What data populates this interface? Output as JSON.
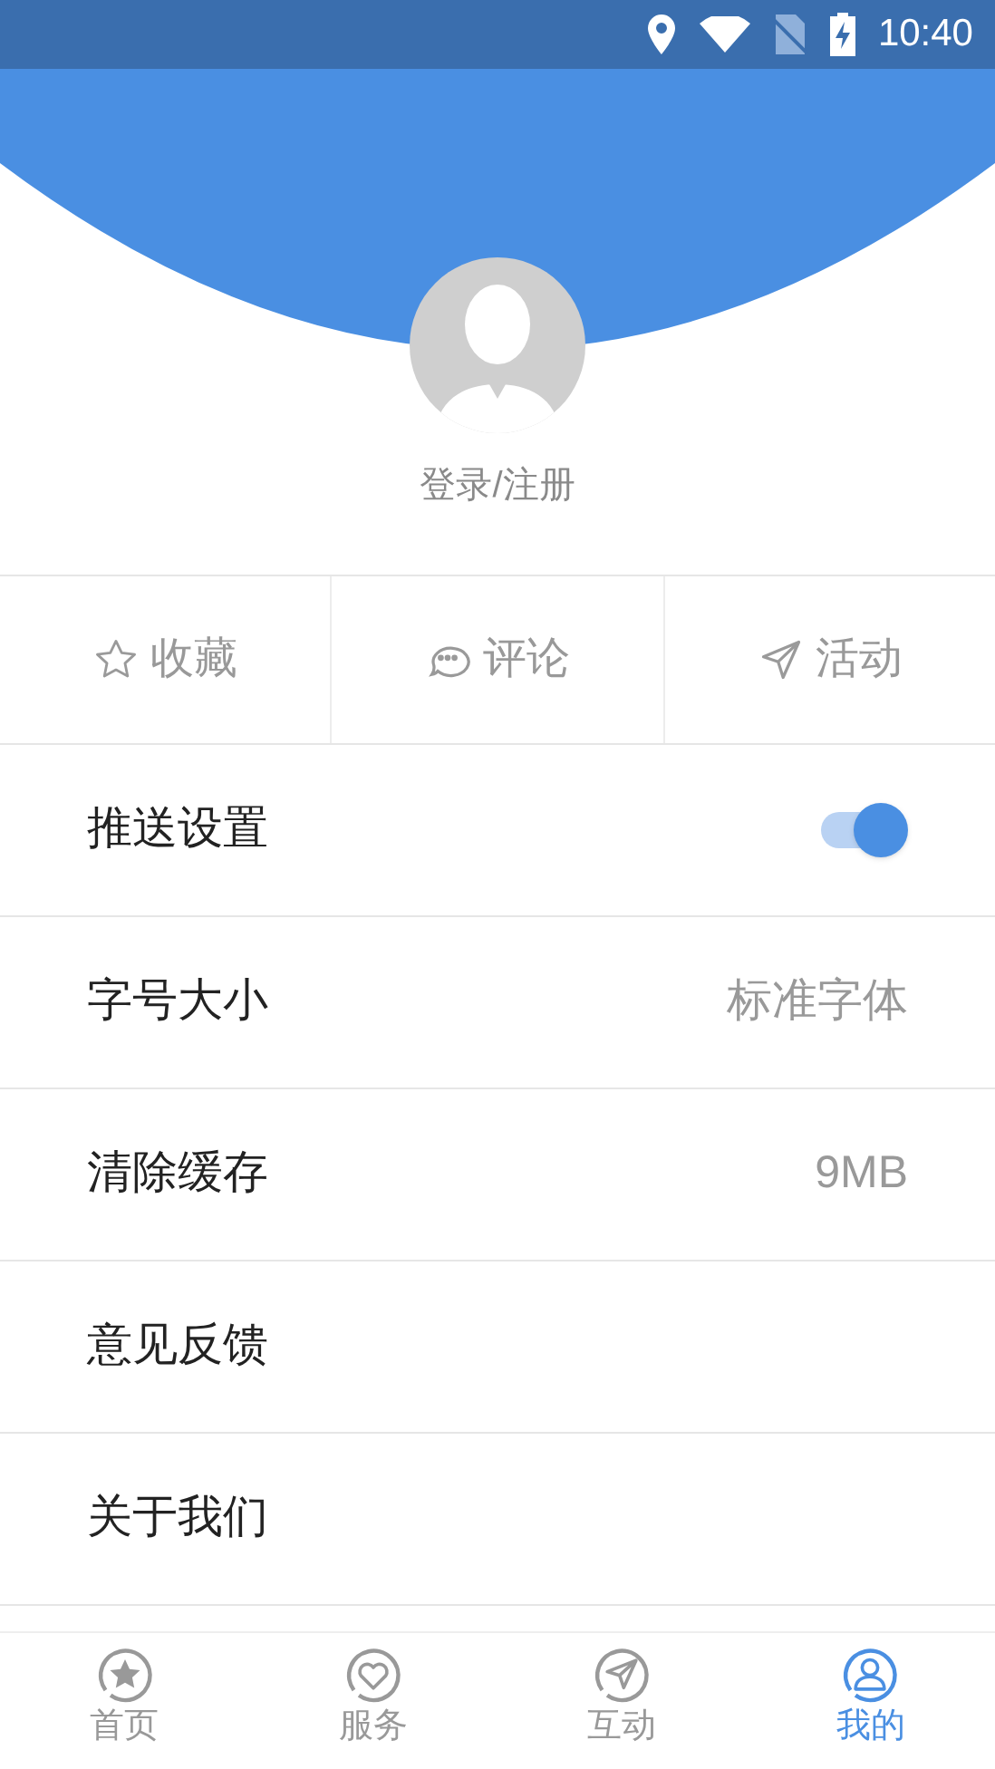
{
  "status_bar": {
    "time": "10:40"
  },
  "profile": {
    "login_label": "登录/注册"
  },
  "quick_actions": [
    {
      "kind": "star",
      "label": "收藏"
    },
    {
      "kind": "comment",
      "label": "评论"
    },
    {
      "kind": "send",
      "label": "活动"
    }
  ],
  "settings": [
    {
      "kind": "toggle",
      "label": "推送设置",
      "on": true
    },
    {
      "kind": "value",
      "label": "字号大小",
      "value": "标准字体"
    },
    {
      "kind": "value",
      "label": "清除缓存",
      "value": "9MB"
    },
    {
      "kind": "plain",
      "label": "意见反馈"
    },
    {
      "kind": "plain",
      "label": "关于我们"
    }
  ],
  "bottom_nav": [
    {
      "kind": "home",
      "label": "首页",
      "selected": false
    },
    {
      "kind": "service",
      "label": "服务",
      "selected": false
    },
    {
      "kind": "interact",
      "label": "互动",
      "selected": false
    },
    {
      "kind": "mine",
      "label": "我的",
      "selected": true
    }
  ]
}
